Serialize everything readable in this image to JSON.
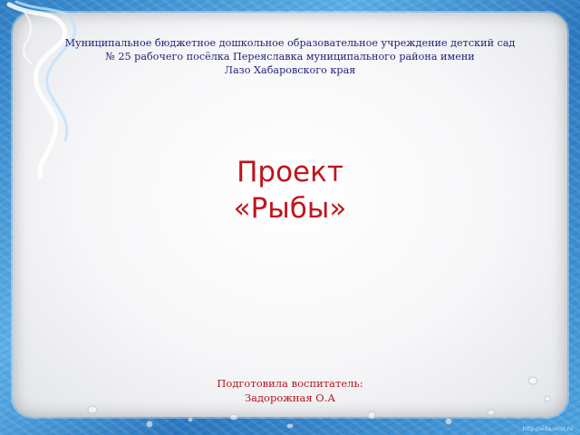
{
  "slide": {
    "header": {
      "line1": "Муниципальное бюджетное дошкольное образовательное  учреждение детский сад",
      "line2": "№ 25 рабочего посёлка Переяславка муниципального района имени",
      "line3": "Лазо Хабаровского края"
    },
    "title": {
      "line1": "Проект",
      "line2": "«Рыбы»"
    },
    "author": {
      "line1": "Подготовила воспитатель:",
      "line2": "Задорожная О.А"
    },
    "watermark": "http://aida.ucoz.ru"
  },
  "colors": {
    "header_text": "#1f1f7a",
    "title_text": "#c0141c",
    "author_text": "#b5161c",
    "frame_blue": "#3a8fd0"
  },
  "decorations": [
    "ribbon-icon",
    "bubble-icon"
  ]
}
